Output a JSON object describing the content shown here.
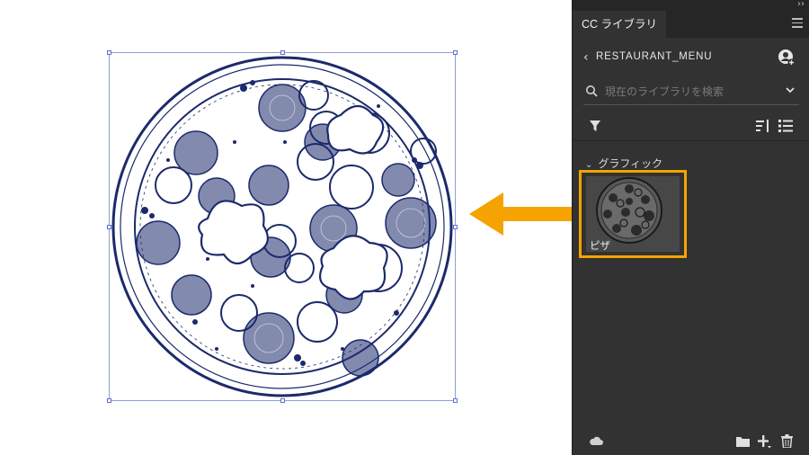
{
  "panel": {
    "tab_title": "CC ライブラリ",
    "collapse_glyph": "››",
    "library_name": "RESTAURANT_MENU",
    "search": {
      "placeholder": "現在のライブラリを検索",
      "value": ""
    },
    "section": {
      "title": "グラフィック"
    },
    "assets": [
      {
        "name": "ピザ"
      }
    ]
  },
  "icons": {
    "menu": "hamburger-menu-icon",
    "back": "chevron-left-icon",
    "user_add": "add-user-icon",
    "search": "search-icon",
    "dropdown": "chevron-down-icon",
    "filter": "filter-icon",
    "sort": "sort-icon",
    "list": "list-view-icon",
    "cloud": "cloud-icon",
    "folder": "folder-icon",
    "add": "plus-icon",
    "trash": "trash-icon"
  },
  "colors": {
    "highlight": "#f5a300",
    "arrow": "#f5a300",
    "panel_bg": "#323232",
    "ink": "#1c2a6b",
    "selection": "#8f9fd6"
  }
}
